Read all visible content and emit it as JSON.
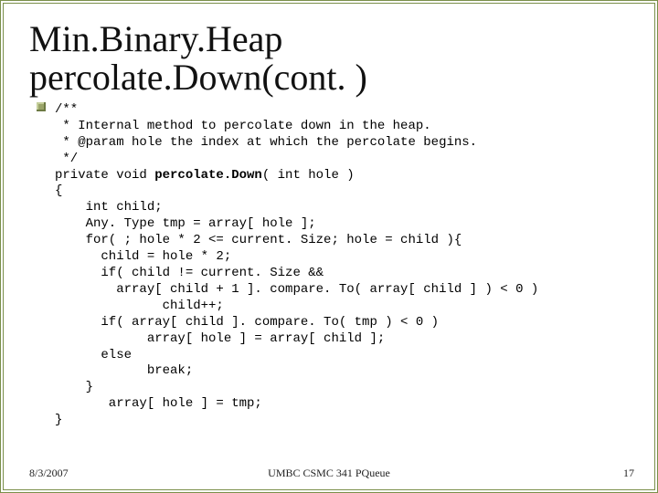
{
  "title": {
    "line1": "Min.Binary.Heap",
    "line2": "percolate.Down(cont. )"
  },
  "code": {
    "l01": "/**",
    "l02": " * Internal method to percolate down in the heap.",
    "l03": " * @param hole the index at which the percolate begins.",
    "l04": " */",
    "l05_a": "private void ",
    "l05_b": "percolate.Down",
    "l05_c": "( int hole )",
    "l06": "{",
    "l07": "    int child;",
    "l08": "    Any. Type tmp = array[ hole ];",
    "l09": "    for( ; hole * 2 <= current. Size; hole = child ){",
    "l10": "      child = hole * 2;",
    "l11": "      if( child != current. Size &&",
    "l12": "        array[ child + 1 ]. compare. To( array[ child ] ) < 0 )",
    "l13": "              child++;",
    "l14": "      if( array[ child ]. compare. To( tmp ) < 0 )",
    "l15": "            array[ hole ] = array[ child ];",
    "l16": "      else",
    "l17": "            break;",
    "l18": "    }",
    "l19": "       array[ hole ] = tmp;",
    "l20": "}"
  },
  "footer": {
    "date": "8/3/2007",
    "center": "UMBC CSMC 341 PQueue",
    "page": "17"
  }
}
